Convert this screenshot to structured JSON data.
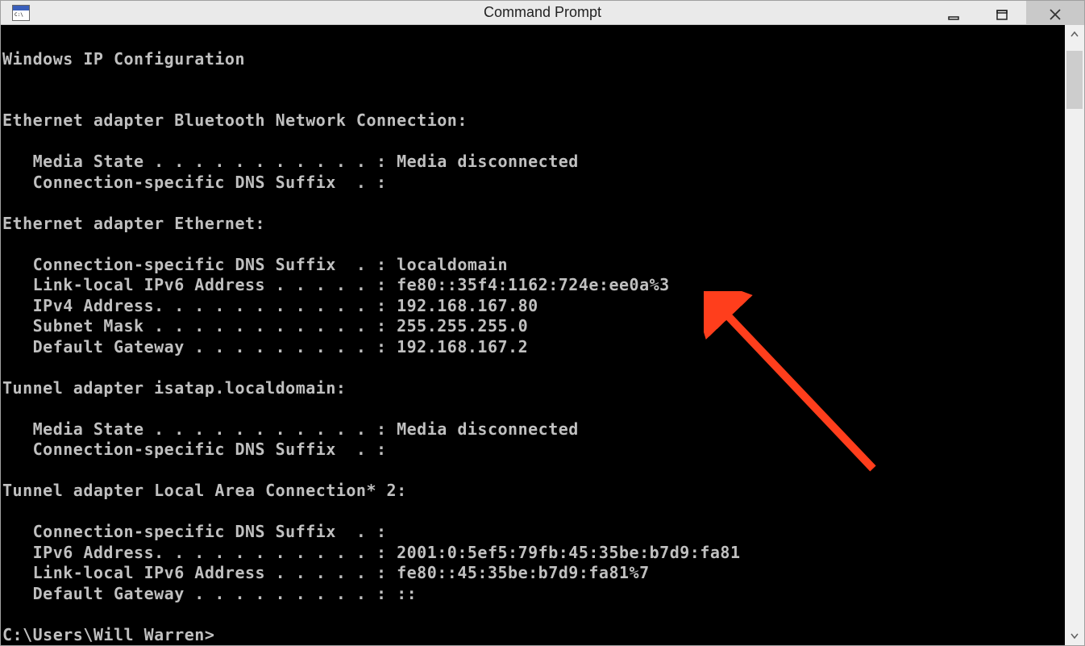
{
  "window": {
    "title": "Command Prompt"
  },
  "console": {
    "lines": [
      "",
      "Windows IP Configuration",
      "",
      "",
      "Ethernet adapter Bluetooth Network Connection:",
      "",
      "   Media State . . . . . . . . . . . : Media disconnected",
      "   Connection-specific DNS Suffix  . :",
      "",
      "Ethernet adapter Ethernet:",
      "",
      "   Connection-specific DNS Suffix  . : localdomain",
      "   Link-local IPv6 Address . . . . . : fe80::35f4:1162:724e:ee0a%3",
      "   IPv4 Address. . . . . . . . . . . : 192.168.167.80",
      "   Subnet Mask . . . . . . . . . . . : 255.255.255.0",
      "   Default Gateway . . . . . . . . . : 192.168.167.2",
      "",
      "Tunnel adapter isatap.localdomain:",
      "",
      "   Media State . . . . . . . . . . . : Media disconnected",
      "   Connection-specific DNS Suffix  . :",
      "",
      "Tunnel adapter Local Area Connection* 2:",
      "",
      "   Connection-specific DNS Suffix  . :",
      "   IPv6 Address. . . . . . . . . . . : 2001:0:5ef5:79fb:45:35be:b7d9:fa81",
      "   Link-local IPv6 Address . . . . . : fe80::45:35be:b7d9:fa81%7",
      "   Default Gateway . . . . . . . . . : ::",
      "",
      "C:\\Users\\Will Warren>"
    ]
  },
  "annotation": {
    "arrowColor": "#ff3e1c"
  }
}
